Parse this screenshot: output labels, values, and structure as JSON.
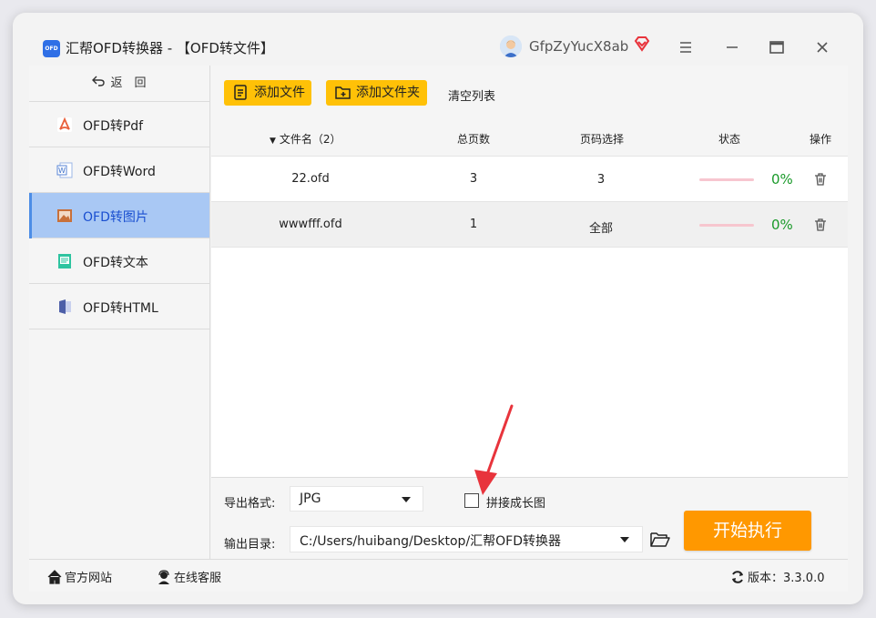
{
  "app": {
    "logo_text": "OFD",
    "title": "汇帮OFD转换器 - 【OFD转文件】",
    "username": "GfpZyYucX8ab"
  },
  "sidebar": {
    "back_label": "返　回",
    "items": [
      {
        "label": "OFD转Pdf",
        "icon": "pdf-icon",
        "active": false
      },
      {
        "label": "OFD转Word",
        "icon": "word-icon",
        "active": false
      },
      {
        "label": "OFD转图片",
        "icon": "image-icon",
        "active": true
      },
      {
        "label": "OFD转文本",
        "icon": "text-icon",
        "active": false
      },
      {
        "label": "OFD转HTML",
        "icon": "html-icon",
        "active": false
      }
    ]
  },
  "toolbar": {
    "add_file": "添加文件",
    "add_folder": "添加文件夹",
    "clear_list": "清空列表"
  },
  "table": {
    "headers": {
      "name": "文件名（2）",
      "pages": "总页数",
      "range": "页码选择",
      "status": "状态",
      "action": "操作"
    },
    "rows": [
      {
        "name": "22.ofd",
        "pages": "3",
        "range": "3",
        "progress": 0,
        "percent": "0%"
      },
      {
        "name": "wwwfff.ofd",
        "pages": "1",
        "range": "全部",
        "progress": 0,
        "percent": "0%"
      }
    ]
  },
  "settings": {
    "format_label": "导出格式:",
    "format_value": "JPG",
    "stitch_label": "拼接成长图",
    "stitch_checked": false,
    "outdir_label": "输出目录:",
    "outdir_value": "C:/Users/huibang/Desktop/汇帮OFD转换器",
    "start_label": "开始执行"
  },
  "footer": {
    "site": "官方网站",
    "support": "在线客服",
    "version": "版本：3.3.0.0"
  },
  "colors": {
    "accent_yellow": "#ffc107",
    "start_orange": "#ff9800",
    "active_blue": "#a9c8f4",
    "percent_green": "#1a9a2a",
    "annotation_red": "#e8343c"
  }
}
